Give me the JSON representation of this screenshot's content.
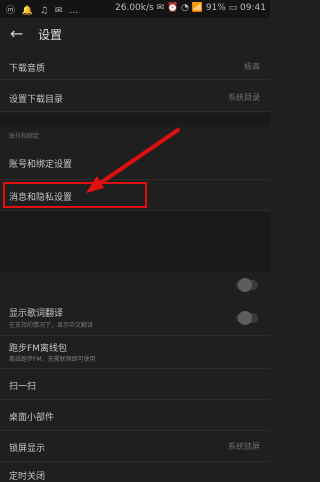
{
  "status": {
    "left": "ⓜ 🔔 ♫ ✉ …",
    "right": "26.00k/s ✉ ⏰ ◔ 📶 91% ▭ 09:41"
  },
  "header": {
    "title": "设置"
  },
  "rows": [
    {
      "label": "下载音质",
      "value": "极高"
    },
    {
      "label": "设置下载目录",
      "value": "系统目录"
    },
    {
      "label": "账号和绑定设置"
    },
    {
      "label": "消息和隐私设置"
    },
    {
      "label": "显示歌词翻译",
      "sub": "在支持的情况下，显示中文翻译"
    },
    {
      "label": "跑步FM离线包",
      "sub": "离线跑步FM，无需联网即可使用"
    },
    {
      "label": "扫一扫"
    },
    {
      "label": "桌面小部件"
    },
    {
      "label": "锁屏显示",
      "value": "系统锁屏"
    },
    {
      "label": "定时关闭"
    }
  ],
  "section": {
    "label": "账号和绑定"
  },
  "colors": {
    "annotation": "#e01010",
    "background": "#1f1f1f"
  }
}
